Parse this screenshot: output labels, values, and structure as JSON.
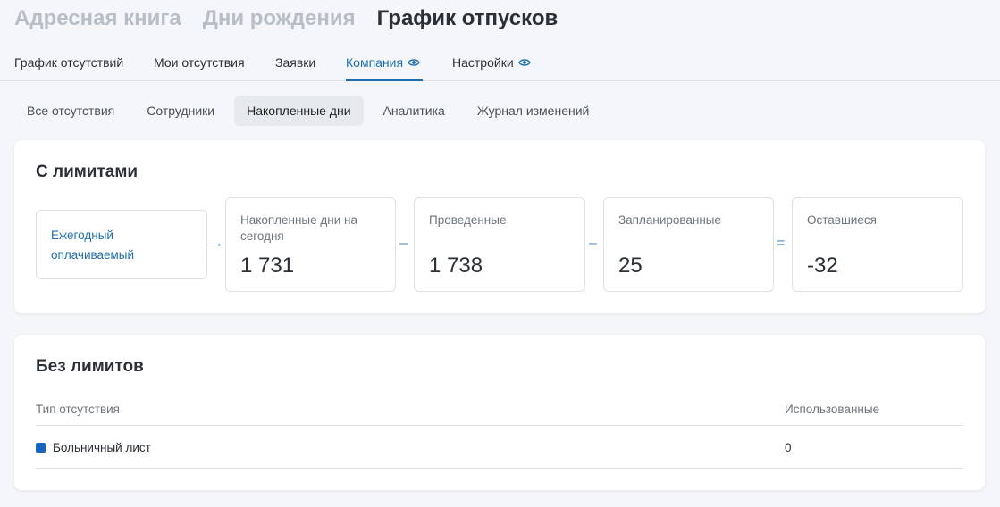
{
  "top_tabs": [
    "Адресная книга",
    "Дни рождения",
    "График отпусков"
  ],
  "main_nav": {
    "items": [
      "График отсутствий",
      "Мои отсутствия",
      "Заявки",
      "Компания",
      "Настройки"
    ]
  },
  "sub_tabs": [
    "Все отсутствия",
    "Сотрудники",
    "Накопленные дни",
    "Аналитика",
    "Журнал изменений"
  ],
  "limited": {
    "title": "С лимитами",
    "type_label_line1": "Ежегодный",
    "type_label_line2": "оплачиваемый",
    "arrow": "→",
    "minus1": "–",
    "minus2": "–",
    "equals": "=",
    "accrued_label_line1": "Накопленные дни на",
    "accrued_label_line2": "сегодня",
    "accrued_value": "1 731",
    "spent_label": "Проведенные",
    "spent_value": "1 738",
    "planned_label": "Запланированные",
    "planned_value": "25",
    "remaining_label": "Оставшиеся",
    "remaining_value": "-32"
  },
  "unlimited": {
    "title": "Без лимитов",
    "col_type": "Тип отсутствия",
    "col_used": "Использованные",
    "rows": [
      {
        "type": "Больничный лист",
        "used": "0",
        "color": "#1565c0"
      }
    ]
  },
  "colors": {
    "accent": "#1f6fb0",
    "sick_leave": "#1565c0"
  },
  "icons": [
    "eye-icon",
    "eye-icon"
  ]
}
